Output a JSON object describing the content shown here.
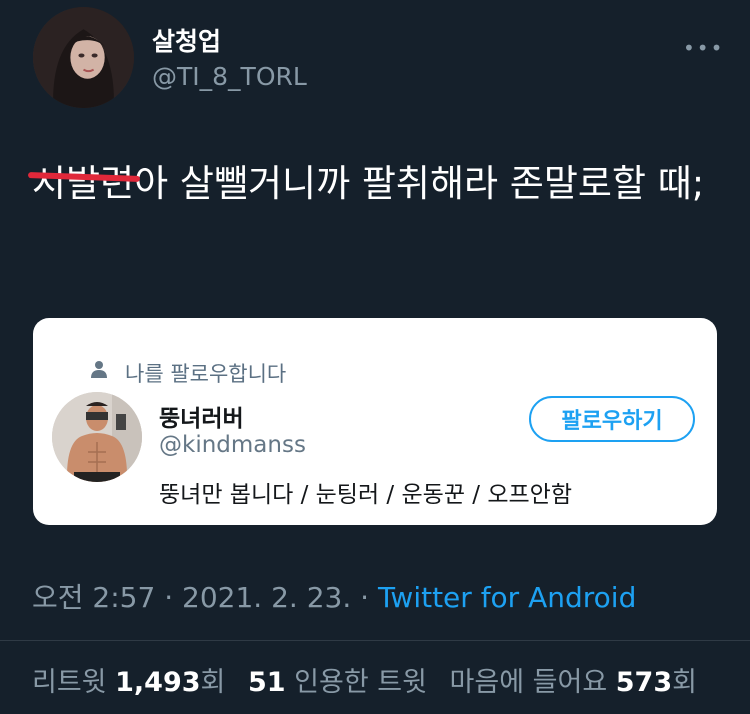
{
  "tweet": {
    "author": {
      "display_name": "살청업",
      "handle": "@TI_8_TORL"
    },
    "text_struck": "시발련",
    "text_rest": "아 살뺄거니까 팔취해라 존말로할 때;",
    "quoted_card": {
      "follows_you": "나를 팔로우합니다",
      "name": "뚱녀러버",
      "handle": "@kindmanss",
      "bio": "뚱녀만 봅니다 / 눈팅러 / 운동꾼 / 오프안함",
      "follow_button": "팔로우하기"
    },
    "meta": {
      "time": "오전 2:57",
      "sep1": "·",
      "date": "2021. 2. 23.",
      "sep2": "·",
      "source": "Twitter for Android"
    },
    "stats": {
      "retweet_label": "리트윗",
      "retweet_count": "1,493",
      "retweet_suffix": "회",
      "quote_count": "51",
      "quote_label": "인용한 트윗",
      "like_label": "마음에 들어요",
      "like_count": "573",
      "like_suffix": "회"
    }
  },
  "colors": {
    "background": "#15202b",
    "accent": "#1da1f2",
    "strike": "#e0283a",
    "muted": "#8899a6"
  },
  "icons": {
    "more": "more-horizontal-icon",
    "follows": "person-icon"
  }
}
